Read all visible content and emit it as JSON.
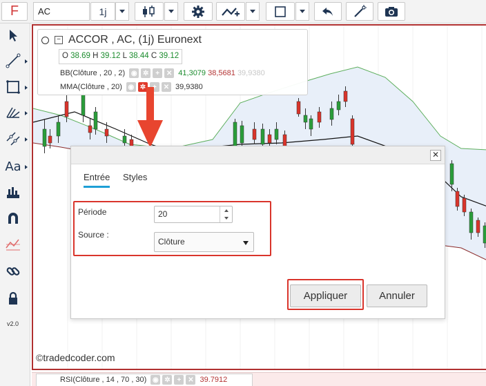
{
  "toolbar": {
    "logo": "F",
    "symbol": "AC",
    "interval": "1j",
    "icons": [
      "candlestick-icon",
      "gear-icon",
      "line-tools-icon",
      "rectangle-icon",
      "undo-icon",
      "magic-wand-icon",
      "camera-icon"
    ]
  },
  "sidebar": {
    "tools": [
      "pointer-icon",
      "trend-line-icon",
      "rectangle-tool-icon",
      "fibonacci-icon",
      "parallel-lines-icon",
      "text-tool-icon",
      "measure-icon",
      "magnet-icon",
      "hide-drawings-icon",
      "link-icon",
      "lock-icon"
    ],
    "text_tool_label": "Aa",
    "version": "v2.0"
  },
  "legend": {
    "title": "ACCOR , AC, (1j) Euronext",
    "ohlc": {
      "o_label": "O",
      "o_value": "38.69",
      "h_label": "H",
      "h_value": "39.12",
      "l_label": "L",
      "l_value": "38.44",
      "c_label": "C",
      "c_value": "39.12"
    },
    "bb": {
      "name": "BB(Clôture , 20 , 2)",
      "upper": "41,3079",
      "lower": "38,5681",
      "mid": "39,9380"
    },
    "mma": {
      "name": "MMA(Clôture , 20)",
      "value": "39,9380"
    }
  },
  "dialog": {
    "tabs": [
      "Entrée",
      "Styles"
    ],
    "active_tab": "Entrée",
    "period_label": "Période",
    "period_value": "20",
    "source_label": "Source :",
    "source_value": "Clôture",
    "apply_label": "Appliquer",
    "cancel_label": "Annuler",
    "close_glyph": "✕"
  },
  "watermark": "©tradedcoder.com",
  "rsi": {
    "name": "RSI(Clôture , 14 , 70 , 30)",
    "value": "39.7912"
  },
  "colors": {
    "up": "#2a9d3a",
    "down": "#d9342b",
    "band_fill": "#e8eff9",
    "band_upper": "#5cae5c",
    "band_lower": "#8a2a2a",
    "highlight": "#d9342b",
    "tab_active": "#1e9fd6"
  }
}
